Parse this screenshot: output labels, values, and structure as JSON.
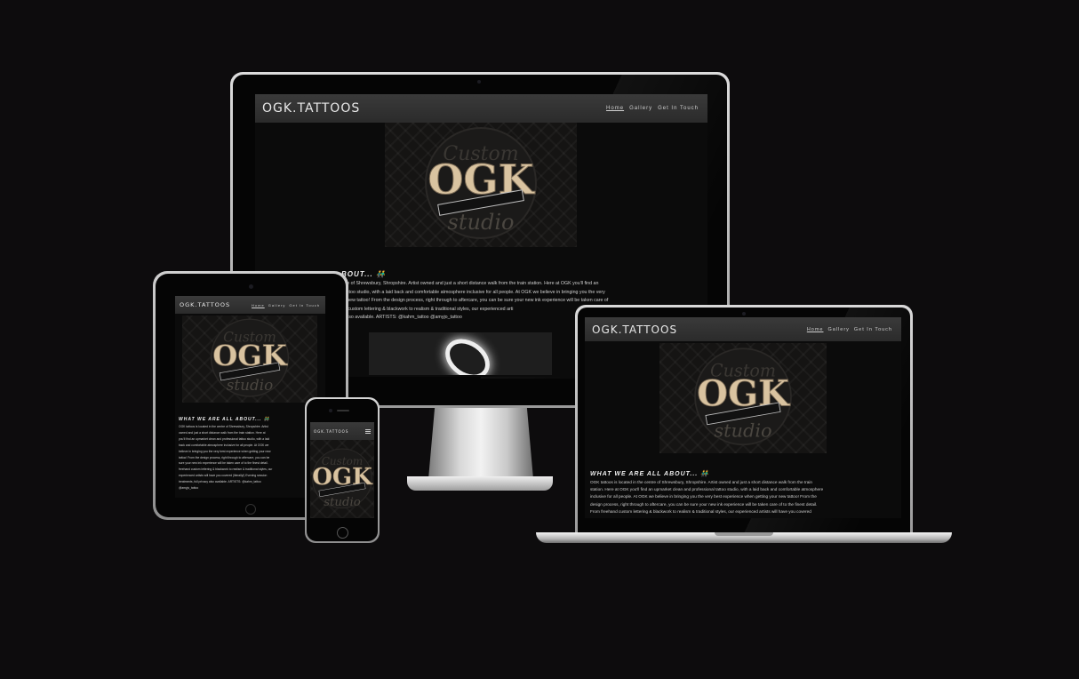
{
  "site": {
    "brand": "OGK.TATTOOS",
    "nav": [
      "Home",
      "Gallery",
      "Get In Touch"
    ],
    "active_nav": "Home",
    "hero_logo_alt": "OGK tattoo studio logo",
    "about_heading": "WHAT WE ARE ALL ABOUT... 👬",
    "about_heading_short": "BOUT... 👬",
    "about_body": "OGK tattoos is located in the centre of Shrewsbury, Shropshire. Artist owned and just a short distance walk from the train station. Here at OGK you'll find an upmarket clean and professional tattoo studio, with a laid back and comfortable atmosphere inclusive for all people. At OGK we believe in bringing you the very best experience when getting your new tattoo! From the design process, right through to aftercare, you can be sure your new ink experience will be taken care of to the finest detail. From freehand custom lettering & blackwork to realism & traditional styles, our experienced artists will have you covered (literally!) Evening session treatments, full privacy also available. ARTISTS: @kahm_tattoo @amyjo_tattoo",
    "desktop_lines": [
      "ntre of Shrewsbury, Shropshire. Artist owned and just a short distance walk from the train station. Here at OGK you'll find an",
      "l tattoo studio, with a laid back and comfortable atmosphere inclusive for all people. At OGK we believe in bringing you the very",
      "ur new tattoo! From the design process, right through to aftercare, you can be sure your new ink experience will be taken care of",
      "nd custom lettering & blackwork to realism & traditional styles, our experienced arti",
      "y also available. ARTISTS: @kahm_tattoo @amyjo_tattoo"
    ],
    "laptop_lines": [
      "OGK tattoos is located in the centre of Shrewsbury, Shropshire. Artist owned and just a short distance walk from the train",
      "station. Here at OGK you'll find an upmarket clean and professional tattoo studio, with a laid back and comfortable atmosphere",
      "inclusive for all people. At OGK we believe in bringing you the very best experience when getting your new tattoo! From the",
      "design process, right through to aftercare, you can be sure your new ink experience will be taken care of to the finest detail.",
      "From freehand custom lettering & blackwork to realism & traditional styles, our experienced artists will have you covered"
    ],
    "tablet_lines": [
      "OGK tattoos is located in the centre of Shrewsbury, Shropshire. Artist",
      "owned and just a short distance walk from the train station. Here at",
      "you'll find an upmarket clean and professional tattoo studio, with a laid",
      "back and comfortable atmosphere inclusive for all people. At OGK we",
      "believe in bringing you the very best experience when getting your new",
      "tattoo! From the design process, right through to aftercare, you can be",
      "sure your new ink experience will be taken care of to the finest detail.",
      "freehand custom lettering & blackwork to realism & traditional styles, our",
      "experienced artists will have you covered (literally!) Evening session",
      "treatments, full privacy also available. ARTISTS: @kahm_tattoo",
      "@amyjo_tattoo"
    ]
  },
  "icons": {
    "hamburger": "hamburger-menu-icon",
    "camera": "camera-icon",
    "home_button": "home-button-icon"
  },
  "colors": {
    "background": "#0d0c0d",
    "nav": "#333333",
    "logo_metal": "#d9c3a0"
  }
}
